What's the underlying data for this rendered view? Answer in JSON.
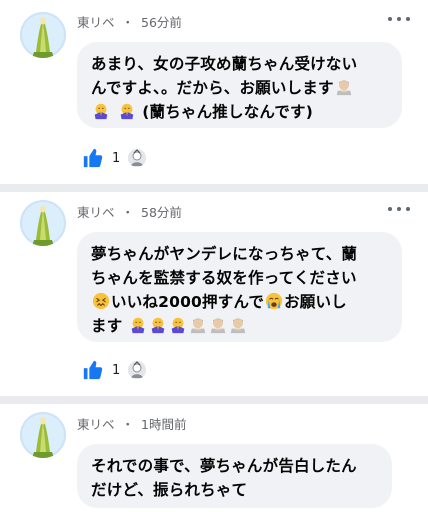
{
  "comments": [
    {
      "author": "東リベ",
      "separator": "・",
      "time": "56分前",
      "lines": [
        "あまり、女の子攻め蘭ちゃん受けない",
        "んですよ、。だから、お願いします",
        "(蘭ちゃん推しなんです)"
      ],
      "like_count": "1"
    },
    {
      "author": "東リベ",
      "separator": "・",
      "time": "58分前",
      "lines": [
        "夢ちゃんがヤンデレになっちゃて、蘭",
        "ちゃんを監禁する奴を作ってください",
        "いいね2000押すんで",
        "お願いし",
        "ます"
      ],
      "like_count": "1"
    },
    {
      "author": "東リベ",
      "separator": "・",
      "time": "1時間前",
      "lines": [
        "それでの事で、夢ちゃんが告白したん",
        "だけど、振られちゃて"
      ]
    }
  ],
  "icons": {
    "like": "thumbs-up-icon",
    "more": "more-options-icon",
    "pray": "folded-hands-emoji",
    "person": "bowing-person-emoji",
    "confounded": "confounded-face-emoji",
    "crying": "crying-face-emoji"
  },
  "colors": {
    "like_blue": "#1877f2",
    "bubble_bg": "#f0f2f5",
    "meta_gray": "#65676b"
  }
}
